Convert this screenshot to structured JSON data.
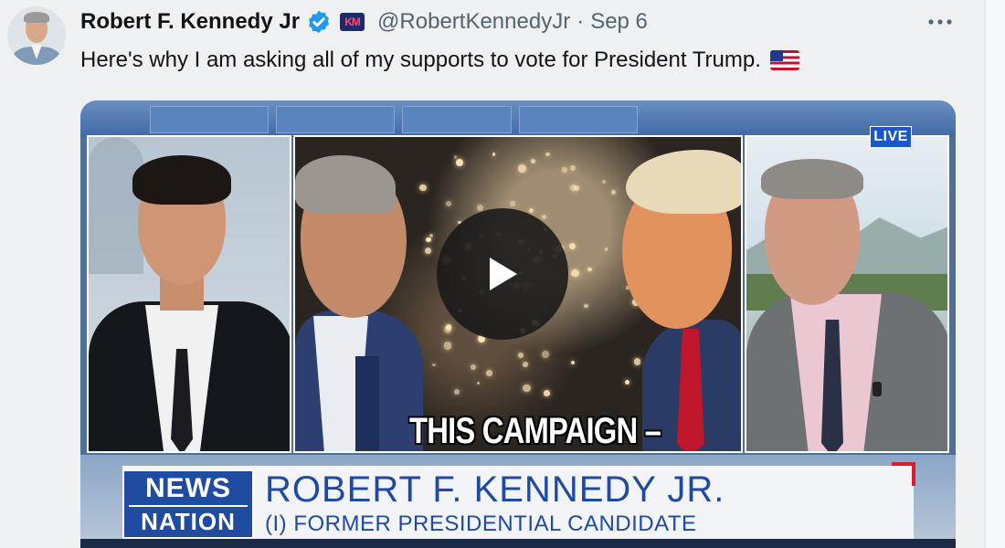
{
  "author": {
    "name": "Robert F. Kennedy Jr",
    "handle": "@RobertKennedyJr",
    "separator": "·",
    "date": "Sep 6",
    "affiliation_badge": "KM"
  },
  "tweet": {
    "text": "Here's why I am asking all of my supports to vote for President Trump."
  },
  "video": {
    "live_badge": "LIVE",
    "caption": "THIS CAMPAIGN –",
    "network_logo_line1": "NEWS",
    "network_logo_line2": "NATION",
    "lower_third_name": "ROBERT F. KENNEDY JR.",
    "lower_third_title": "(I) FORMER PRESIDENTIAL CANDIDATE"
  },
  "icons": {
    "verified": "verified-badge-icon",
    "more": "more-options-icon",
    "flag": "us-flag-icon",
    "play": "play-icon"
  },
  "colors": {
    "verified_blue": "#1d9bf0",
    "text_primary": "#0f1419",
    "text_secondary": "#536471",
    "newsnation_blue": "#1f4ca0",
    "live_blue": "#1a57c9",
    "lower_third_red": "#d31f2e"
  }
}
